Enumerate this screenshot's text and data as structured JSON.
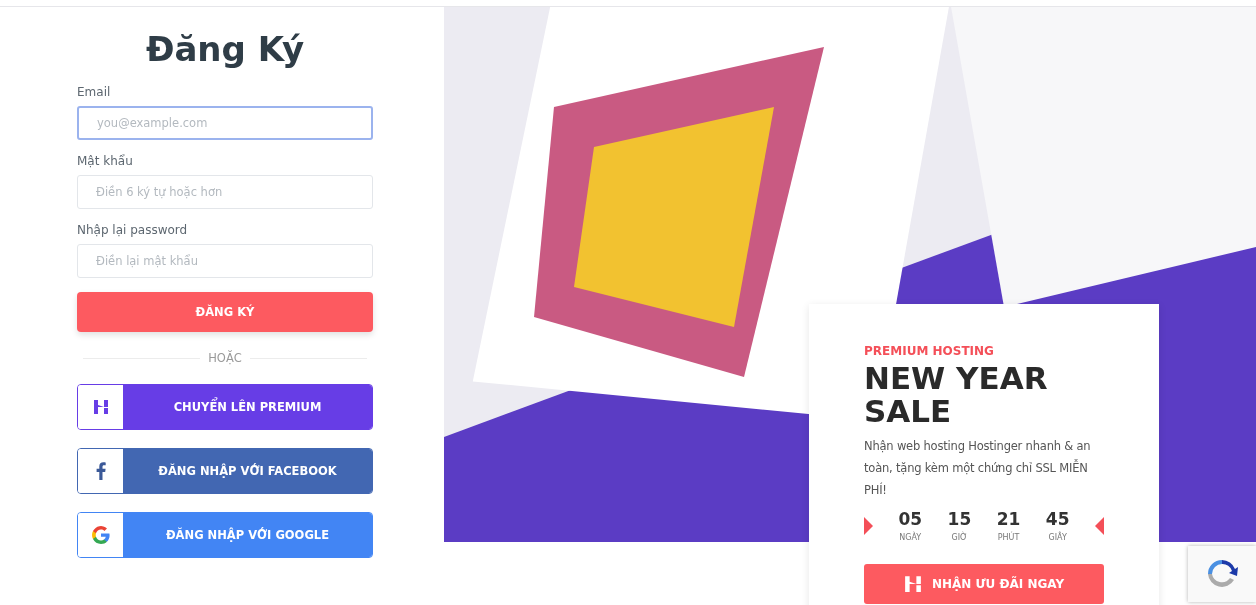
{
  "signup": {
    "title": "Đăng Ký",
    "fields": [
      {
        "label": "Email",
        "placeholder": "you@example.com",
        "focused": true
      },
      {
        "label": "Mật khẩu",
        "placeholder": "Điền 6 ký tự hoặc hơn",
        "focused": false
      },
      {
        "label": "Nhập lại password",
        "placeholder": "Điền lại mật khẩu",
        "focused": false
      }
    ],
    "submit": "ĐĂNG KÝ",
    "divider": "HOẶC",
    "social_buttons": [
      {
        "kind": "hostinger",
        "label": "CHUYỂN LÊN PREMIUM"
      },
      {
        "kind": "facebook",
        "label": "ĐĂNG NHẬP VỚI FACEBOOK"
      },
      {
        "kind": "google",
        "label": "ĐĂNG NHẬP VỚI GOOGLE"
      }
    ]
  },
  "promo": {
    "eyebrow": "PREMIUM HOSTING",
    "title": "NEW YEAR SALE",
    "description": "Nhận web hosting Hostinger nhanh & an toàn, tặng kèm một chứng chỉ SSL MIỄN PHÍ!",
    "countdown": [
      {
        "value": "05",
        "unit": "NGÀY"
      },
      {
        "value": "15",
        "unit": "GIỜ"
      },
      {
        "value": "21",
        "unit": "PHÚT"
      },
      {
        "value": "45",
        "unit": "GIÂY"
      }
    ],
    "cta": "NHẬN ƯU ĐÃI NGAY"
  }
}
